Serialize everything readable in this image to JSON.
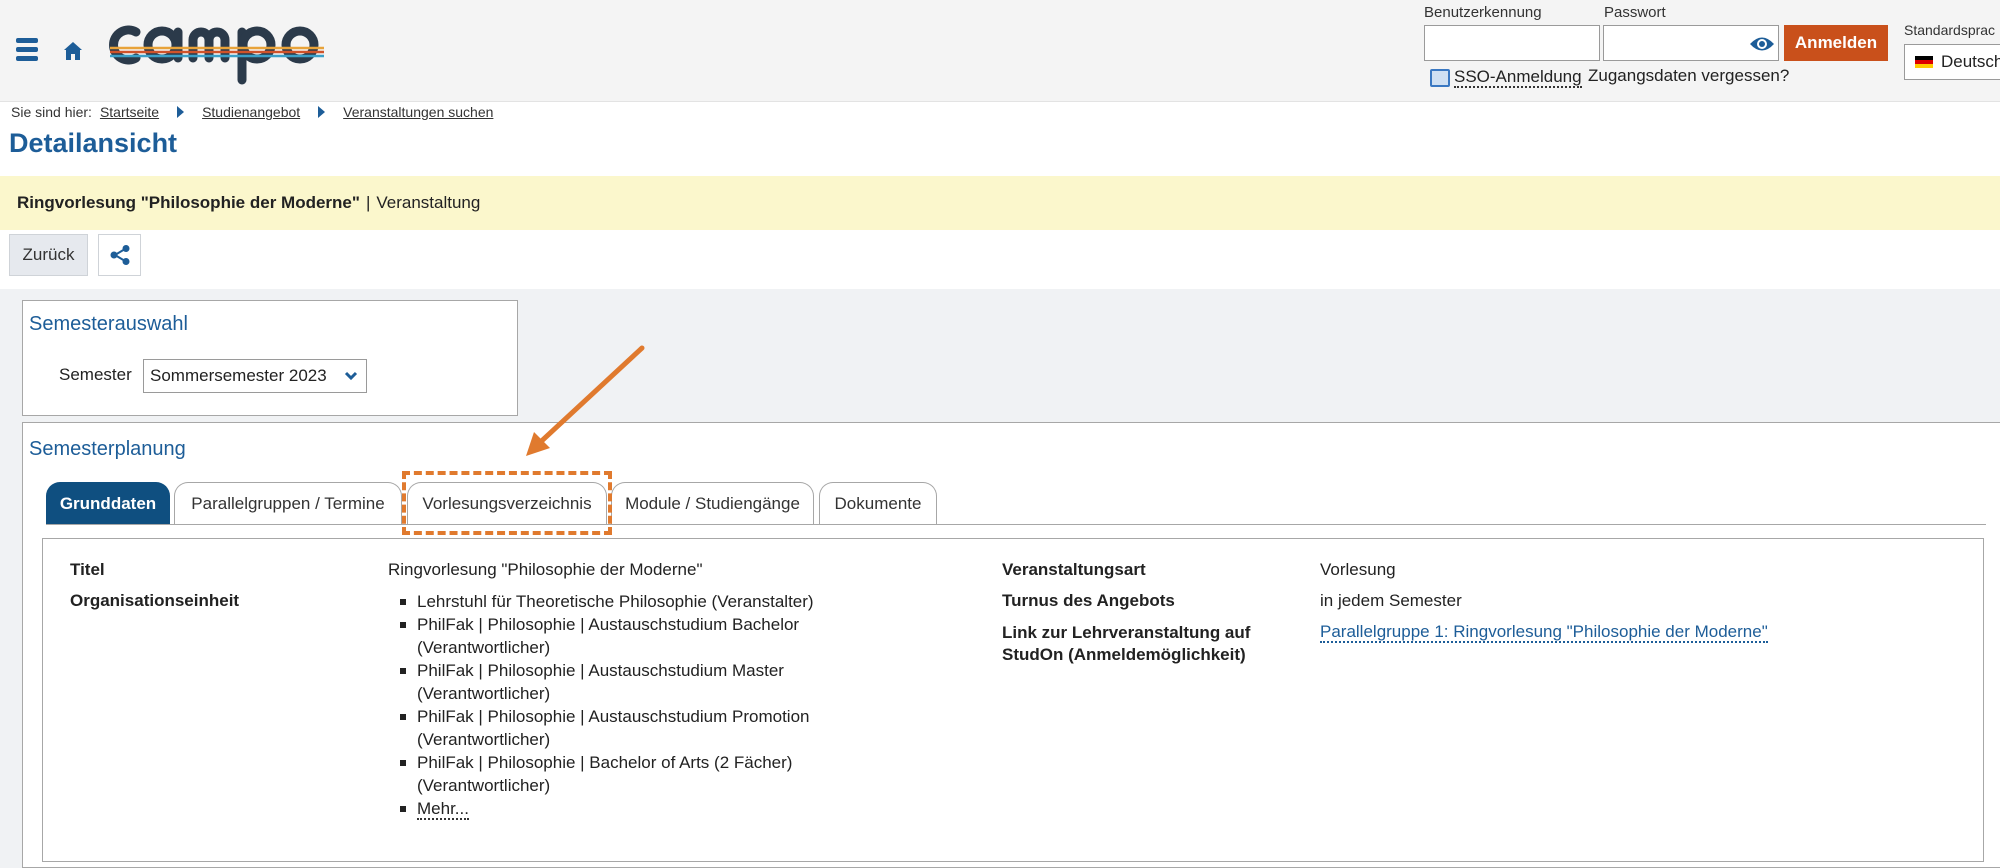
{
  "header": {
    "logo_text": "campo",
    "username_label": "Benutzerkennung",
    "username_value": "",
    "password_label": "Passwort",
    "password_value": "",
    "login_button": "Anmelden",
    "sso_label": "SSO-Anmeldung",
    "forgot_label": "Zugangsdaten vergessen?",
    "language_label": "Standardsprac",
    "language_value": "Deutsch"
  },
  "breadcrumb": {
    "label": "Sie sind hier:",
    "items": [
      "Startseite",
      "Studienangebot",
      "Veranstaltungen suchen"
    ]
  },
  "page": {
    "title": "Detailansicht",
    "event_title": "Ringvorlesung \"Philosophie der Moderne\"",
    "event_separator": "|",
    "event_type": "Veranstaltung",
    "back_button": "Zurück"
  },
  "semester_selection": {
    "heading": "Semesterauswahl",
    "label": "Semester",
    "value": "Sommersemester 2023"
  },
  "semester_planning": {
    "heading": "Semesterplanung",
    "tabs": [
      {
        "label": "Grunddaten",
        "active": true
      },
      {
        "label": "Parallelgruppen / Termine",
        "active": false
      },
      {
        "label": "Vorlesungsverzeichnis",
        "active": false
      },
      {
        "label": "Module / Studiengänge",
        "active": false
      },
      {
        "label": "Dokumente",
        "active": false
      }
    ]
  },
  "details": {
    "titel_label": "Titel",
    "titel_value": "Ringvorlesung \"Philosophie der Moderne\"",
    "org_label": "Organisationseinheit",
    "org_items": [
      "Lehrstuhl für Theoretische Philosophie (Veranstalter)",
      "PhilFak | Philosophie | Austauschstudium Bachelor (Verantwortlicher)",
      "PhilFak | Philosophie | Austauschstudium Master (Verantwortlicher)",
      "PhilFak | Philosophie | Austauschstudium Promotion (Verantwortlicher)",
      "PhilFak | Philosophie | Bachelor of Arts (2 Fächer) (Verantwortlicher)"
    ],
    "org_more": "Mehr...",
    "art_label": "Veranstaltungsart",
    "art_value": "Vorlesung",
    "turnus_label": "Turnus des Angebots",
    "turnus_value": "in jedem Semester",
    "link_label": "Link zur Lehrveranstaltung auf StudOn (Anmeldemöglichkeit)",
    "link_value": "Parallelgruppe 1: Ringvorlesung \"Philosophie der Moderne\""
  },
  "colors": {
    "brand_blue": "#1d5d98",
    "active_tab": "#0f4f80",
    "login_button": "#c9501b",
    "highlight": "#e07a2e",
    "title_bar": "#fbf7cc"
  }
}
